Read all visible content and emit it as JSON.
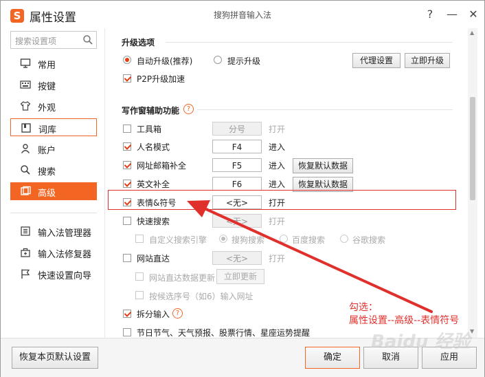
{
  "window": {
    "title": "属性设置",
    "subtitle": "搜狗拼音输入法",
    "help": "?",
    "minimize": "—",
    "close": "✕"
  },
  "sidebar": {
    "search_placeholder": "搜索设置项",
    "items": [
      {
        "label": "常用",
        "icon": "monitor-icon"
      },
      {
        "label": "按键",
        "icon": "keyboard-icon"
      },
      {
        "label": "外观",
        "icon": "shirt-icon"
      },
      {
        "label": "词库",
        "icon": "book-icon"
      },
      {
        "label": "账户",
        "icon": "user-icon"
      },
      {
        "label": "搜索",
        "icon": "search-icon"
      },
      {
        "label": "高级",
        "icon": "advanced-icon"
      }
    ],
    "tools": [
      {
        "label": "输入法管理器",
        "icon": "manager-icon"
      },
      {
        "label": "输入法修复器",
        "icon": "repair-icon"
      },
      {
        "label": "快速设置向导",
        "icon": "flag-icon"
      }
    ]
  },
  "upgrade": {
    "title": "升级选项",
    "auto": "自动升级(推荐)",
    "prompt": "提示升级",
    "proxy_button": "代理设置",
    "now_button": "立即升级",
    "p2p": "P2P升级加速"
  },
  "writing": {
    "title": "写作窗辅助功能",
    "help": "?",
    "rows": [
      {
        "label": "工具箱",
        "key": "分号",
        "action": "打开",
        "checked": false
      },
      {
        "label": "人名模式",
        "key": "F4",
        "action": "进入",
        "checked": true
      },
      {
        "label": "网址邮箱补全",
        "key": "F5",
        "action": "进入",
        "checked": true,
        "restore": "恢复默认数据"
      },
      {
        "label": "英文补全",
        "key": "F6",
        "action": "进入",
        "checked": true,
        "restore": "恢复默认数据"
      },
      {
        "label": "表情&符号",
        "key": "<无>",
        "action": "打开",
        "checked": true
      },
      {
        "label": "快速搜索",
        "key": "<无>",
        "action": "打开",
        "checked": false
      }
    ],
    "custom_engine": "自定义搜索引擎",
    "engines": [
      "搜狗搜索",
      "百度搜索",
      "谷歌搜索"
    ],
    "site_direct": {
      "label": "网站直达",
      "key": "<无>",
      "action": "打开"
    },
    "site_update": "网站直达数据更新",
    "update_now": "立即更新",
    "candidate_url": "按候选序号（如6）输入网址",
    "split_input": "拆分输入",
    "split_help": "?",
    "festival": "节日节气、天气预报、股票行情、星座运势提醒"
  },
  "footer": {
    "restore": "恢复本页默认设置",
    "ok": "确定",
    "cancel": "取消",
    "apply": "应用"
  },
  "annotation": {
    "line1": "勾选：",
    "line2": "属性设置--高级--表情符号"
  },
  "watermark": "Baidu 经验",
  "colors": {
    "accent": "#f26522",
    "annotation": "#e0302c"
  }
}
